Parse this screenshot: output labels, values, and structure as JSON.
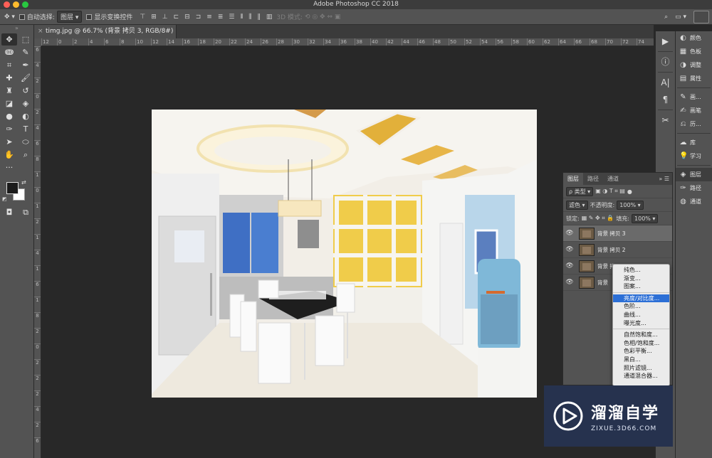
{
  "window": {
    "title": "Adobe Photoshop CC 2018"
  },
  "options_bar": {
    "auto_select_label": "自动选择:",
    "auto_select_value": "图层",
    "show_transform_label": "显示变换控件",
    "mode_3d_label": "3D 模式:"
  },
  "document_tab": {
    "title": "timg.jpg @ 66.7% (背景 拷贝 3, RGB/8#) *",
    "close": "×"
  },
  "ruler": {
    "h_ticks": [
      "12",
      "0",
      "2",
      "4",
      "6",
      "8",
      "10",
      "12",
      "14",
      "16",
      "18",
      "20",
      "22",
      "24",
      "26",
      "28",
      "30",
      "32",
      "34",
      "36",
      "38",
      "40",
      "42",
      "44",
      "46",
      "48",
      "50",
      "52",
      "54",
      "56",
      "58",
      "60",
      "62",
      "64",
      "66",
      "68",
      "70",
      "72",
      "74"
    ],
    "v_ticks": [
      "6",
      "4",
      "2",
      "0",
      "2",
      "4",
      "6",
      "8",
      "1",
      "0",
      "1",
      "2",
      "1",
      "4",
      "1",
      "6",
      "1",
      "8",
      "2",
      "0",
      "2",
      "2",
      "2",
      "4",
      "2",
      "6"
    ]
  },
  "tools": [
    {
      "name": "move-tool",
      "glyph": "✥"
    },
    {
      "name": "marquee-tool",
      "glyph": "⬚"
    },
    {
      "name": "lasso-tool",
      "glyph": "ↈ"
    },
    {
      "name": "quick-select-tool",
      "glyph": "✎"
    },
    {
      "name": "crop-tool",
      "glyph": "⌗"
    },
    {
      "name": "eyedropper-tool",
      "glyph": "✒"
    },
    {
      "name": "healing-tool",
      "glyph": "✚"
    },
    {
      "name": "brush-tool",
      "glyph": "🖌"
    },
    {
      "name": "stamp-tool",
      "glyph": "♜"
    },
    {
      "name": "history-brush-tool",
      "glyph": "↺"
    },
    {
      "name": "eraser-tool",
      "glyph": "◪"
    },
    {
      "name": "bucket-tool",
      "glyph": "◈"
    },
    {
      "name": "blur-tool",
      "glyph": "●"
    },
    {
      "name": "dodge-tool",
      "glyph": "◐"
    },
    {
      "name": "pen-tool",
      "glyph": "✑"
    },
    {
      "name": "type-tool",
      "glyph": "T"
    },
    {
      "name": "path-select-tool",
      "glyph": "➤"
    },
    {
      "name": "shape-tool",
      "glyph": "⬭"
    },
    {
      "name": "hand-tool",
      "glyph": "✋"
    },
    {
      "name": "zoom-tool",
      "glyph": "⌕"
    },
    {
      "name": "more-tools",
      "glyph": "···"
    }
  ],
  "right_panels": [
    {
      "label": "颜色",
      "glyph": "◐"
    },
    {
      "label": "色板",
      "glyph": "▦"
    },
    {
      "label": "调整",
      "glyph": "◑"
    },
    {
      "label": "属性",
      "glyph": "▤"
    },
    {
      "label": "画...",
      "glyph": "✎"
    },
    {
      "label": "画笔",
      "glyph": "✍"
    },
    {
      "label": "历...",
      "glyph": "⎌"
    },
    {
      "label": "库",
      "glyph": "☁"
    },
    {
      "label": "学习",
      "glyph": "💡"
    },
    {
      "label": "图层",
      "glyph": "◈"
    },
    {
      "label": "路径",
      "glyph": "✑"
    },
    {
      "label": "通道",
      "glyph": "◍"
    }
  ],
  "layers_panel": {
    "tabs": [
      "图层",
      "路径",
      "通道"
    ],
    "kind_filter": "ρ 类型",
    "blend_mode": "滤色",
    "opacity_label": "不透明度:",
    "opacity_value": "100%",
    "lock_label": "锁定:",
    "fill_label": "填充:",
    "fill_value": "100%",
    "layers": [
      {
        "name": "背景 拷贝 3",
        "selected": true
      },
      {
        "name": "背景 拷贝 2",
        "selected": false
      },
      {
        "name": "背景 拷",
        "selected": false
      },
      {
        "name": "背景",
        "selected": false
      }
    ]
  },
  "context_menu": {
    "groups": [
      [
        "纯色...",
        "渐变...",
        "图案..."
      ],
      [
        "亮度/对比度...",
        "色阶...",
        "曲线...",
        "曝光度..."
      ],
      [
        "自然饱和度...",
        "色相/饱和度...",
        "色彩平衡...",
        "黑白...",
        "照片滤镜...",
        "通道混合器..."
      ]
    ],
    "highlighted": "亮度/对比度..."
  },
  "watermark": {
    "title": "溜溜自学",
    "url": "ZIXUE.3D66.COM"
  },
  "colors": {
    "highlight": "#2c6fd6",
    "panel": "#535353",
    "canvas_bg": "#282828"
  }
}
